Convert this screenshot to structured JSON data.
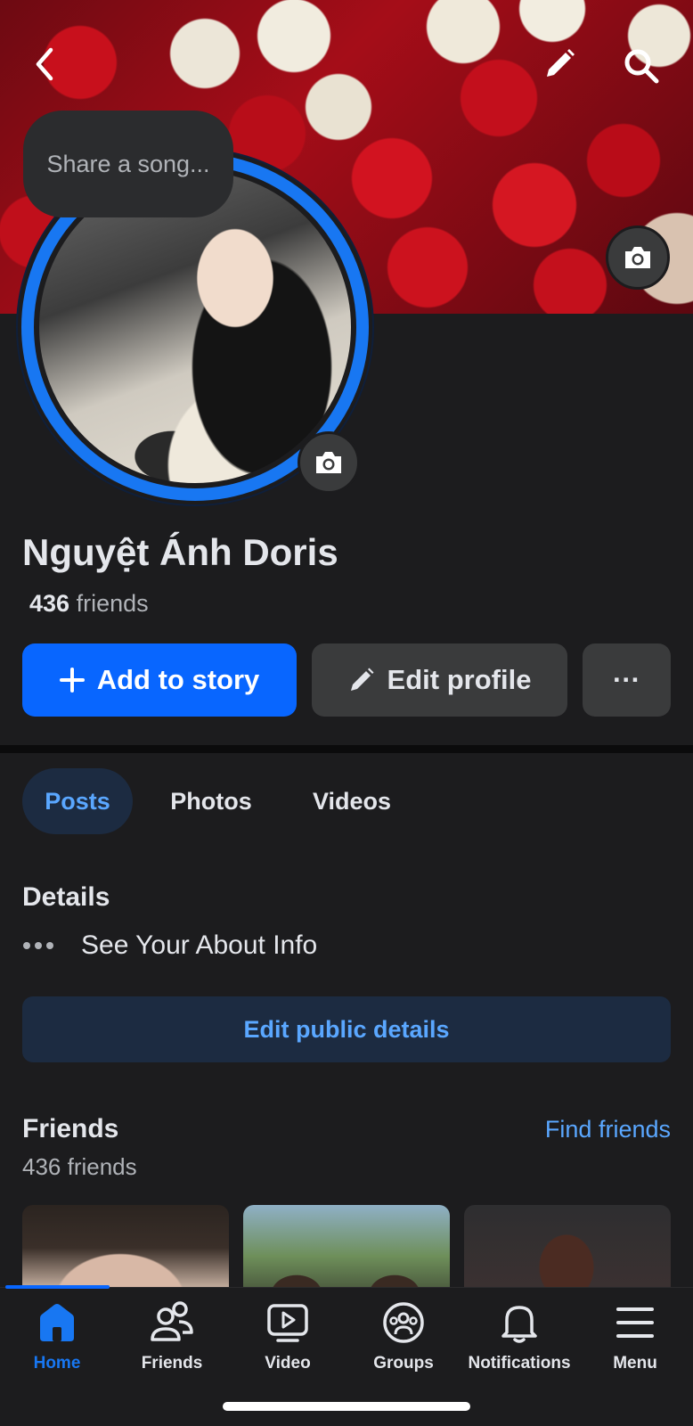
{
  "profile": {
    "name": "Nguyệt Ánh Doris",
    "friends_count": "436",
    "friends_word": "friends",
    "song_prompt": "Share a song..."
  },
  "actions": {
    "add_story": "Add to story",
    "edit_profile": "Edit profile",
    "more": "···"
  },
  "tabs": [
    {
      "label": "Posts",
      "active": true
    },
    {
      "label": "Photos",
      "active": false
    },
    {
      "label": "Videos",
      "active": false
    }
  ],
  "details": {
    "title": "Details",
    "about_label": "See Your About Info",
    "edit_public": "Edit public details"
  },
  "friends_section": {
    "title": "Friends",
    "find_friends": "Find friends",
    "count_text": "436 friends"
  },
  "bottom_nav": [
    {
      "label": "Home",
      "icon": "home-icon",
      "active": true
    },
    {
      "label": "Friends",
      "icon": "friends-icon",
      "active": false
    },
    {
      "label": "Video",
      "icon": "video-icon",
      "active": false
    },
    {
      "label": "Groups",
      "icon": "groups-icon",
      "active": false
    },
    {
      "label": "Notifications",
      "icon": "bell-icon",
      "active": false
    },
    {
      "label": "Menu",
      "icon": "menu-icon",
      "active": false
    }
  ],
  "colors": {
    "accent": "#0866ff",
    "link": "#5aa7ff",
    "background": "#1c1c1e",
    "surface": "#3a3b3c"
  }
}
